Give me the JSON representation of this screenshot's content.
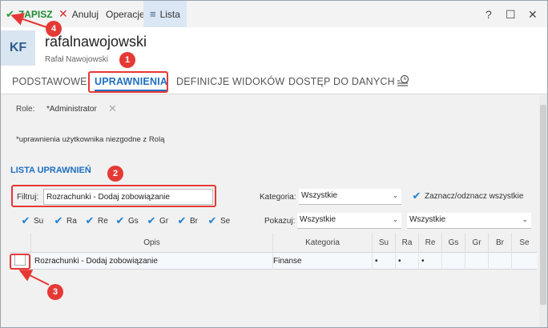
{
  "toolbar": {
    "save_label": "ZAPISZ",
    "cancel_label": "Anuluj",
    "operations_label": "Operacje",
    "list_label": "Lista",
    "help": "?",
    "maximize": "☐",
    "close": "✕"
  },
  "header": {
    "avatar": "KF",
    "title": "rafalnawojowski",
    "subtitle": "Rafał Nawojowski"
  },
  "tabs": [
    {
      "label": "PODSTAWOWE"
    },
    {
      "label": "UPRAWNIENIA"
    },
    {
      "label": "DEFINICJE WIDOKÓW"
    },
    {
      "label": "DOSTĘP DO DANYCH"
    }
  ],
  "role": {
    "label": "Role:",
    "value": "*Administrator",
    "remove": "✕"
  },
  "note": "*uprawnienia użytkownika niezgodne z Rolą",
  "section_title": "LISTA UPRAWNIEŃ",
  "filter": {
    "label": "Filtruj:",
    "value": "Rozrachunki - Dodaj zobowiązanie"
  },
  "category": {
    "label": "Kategoria:",
    "value": "Wszystkie"
  },
  "toggle_all_label": "Zaznacz/odznacz wszystkie",
  "show": {
    "label": "Pokazuj:",
    "value1": "Wszystkie",
    "value2": "Wszystkie"
  },
  "permissions": [
    "Su",
    "Ra",
    "Re",
    "Gs",
    "Gr",
    "Br",
    "Se"
  ],
  "table": {
    "headers": [
      "Opis",
      "Kategoria",
      "Su",
      "Ra",
      "Re",
      "Gs",
      "Gr",
      "Br",
      "Se"
    ],
    "rows": [
      {
        "opis": "Rozrachunki - Dodaj zobowiązanie",
        "kategoria": "Finanse",
        "su": "•",
        "ra": "•",
        "re": "•",
        "gs": "",
        "gr": "",
        "br": "",
        "se": ""
      }
    ]
  },
  "callouts": [
    "1",
    "2",
    "3",
    "4"
  ],
  "colors": {
    "accent": "#1e6fbf",
    "highlight": "#e53935",
    "save": "#1e8a2e"
  }
}
